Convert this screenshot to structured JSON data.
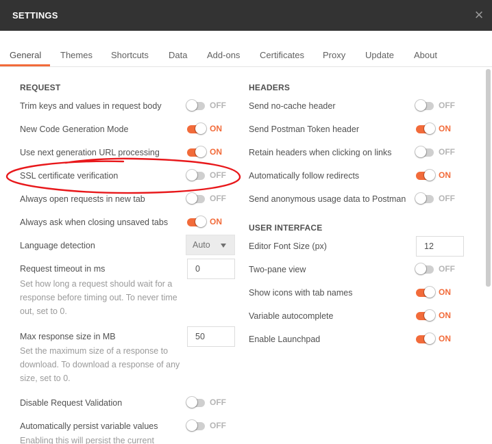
{
  "window": {
    "title": "SETTINGS"
  },
  "tabs": [
    "General",
    "Themes",
    "Shortcuts",
    "Data",
    "Add-ons",
    "Certificates",
    "Proxy",
    "Update",
    "About"
  ],
  "active_tab": "General",
  "toggle_labels": {
    "on": "ON",
    "off": "OFF"
  },
  "colors": {
    "accent": "#f26b3a",
    "titlebar": "#333333",
    "toggle_off": "#cfcfcf",
    "annotation": "#e8181b"
  },
  "request": {
    "title": "REQUEST",
    "trim_keys": {
      "label": "Trim keys and values in request body",
      "on": false
    },
    "code_generation": {
      "label": "New Code Generation Mode",
      "on": true
    },
    "url_processing": {
      "label": "Use next generation URL processing",
      "on": true
    },
    "ssl_verification": {
      "label": "SSL certificate verification",
      "on": false
    },
    "new_tab": {
      "label": "Always open requests in new tab",
      "on": false
    },
    "ask_closing": {
      "label": "Always ask when closing unsaved tabs",
      "on": true
    },
    "language_detection": {
      "label": "Language detection",
      "value": "Auto"
    },
    "timeout": {
      "label": "Request timeout in ms",
      "value": "0",
      "description": "Set how long a request should wait for a response before timing out. To never time out, set to 0."
    },
    "max_response": {
      "label": "Max response size in MB",
      "value": "50",
      "description": "Set the maximum size of a response to download. To download a response of any size, set to 0."
    },
    "disable_validation": {
      "label": "Disable Request Validation",
      "on": false
    },
    "persist_variables": {
      "label": "Automatically persist variable values",
      "on": false,
      "description": "Enabling this will persist the current"
    }
  },
  "headers": {
    "title": "HEADERS",
    "no_cache": {
      "label": "Send no-cache header",
      "on": false
    },
    "postman_token": {
      "label": "Send Postman Token header",
      "on": true
    },
    "retain_headers": {
      "label": "Retain headers when clicking on links",
      "on": false
    },
    "follow_redirects": {
      "label": "Automatically follow redirects",
      "on": true
    },
    "usage_data": {
      "label": "Send anonymous usage data to Postman",
      "on": false
    }
  },
  "ui": {
    "title": "USER INTERFACE",
    "font_size": {
      "label": "Editor Font Size (px)",
      "value": "12"
    },
    "two_pane": {
      "label": "Two-pane view",
      "on": false
    },
    "tab_icons": {
      "label": "Show icons with tab names",
      "on": true
    },
    "variable_autocomplete": {
      "label": "Variable autocomplete",
      "on": true
    },
    "launchpad": {
      "label": "Enable Launchpad",
      "on": true
    }
  }
}
